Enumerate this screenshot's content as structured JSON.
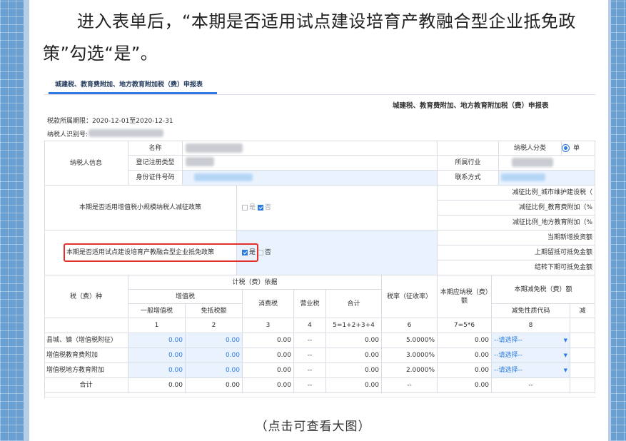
{
  "article": {
    "intro": "进入表单后，“本期是否适用试点建设培育产教融合型企业抵免政策”勾选“是”。",
    "caption": "（点击可查看大图）"
  },
  "form": {
    "tab": "城建税、教育费附加、地方教育附加税（费）申报表",
    "title": "城建税、教育费附加、地方教育附加税（费）申报表",
    "period": "税款所属期限：2020-12-01至2020-12-31",
    "taxid_label": "纳税人识别号:",
    "info": {
      "section": "纳税人信息",
      "name": "名称",
      "reg_type": "登记注册类型",
      "id_no": "身份证件号码",
      "category": "纳税人分类",
      "category_value": "单",
      "industry": "所属行业",
      "contact": "联系方式"
    },
    "q1": {
      "label": "本期是否适用增值税小规模纳税人减征政策",
      "yes": "是",
      "no": "否"
    },
    "q2": {
      "label": "本期是否适用试点建设培育产教融合型企业抵免政策",
      "yes": "是",
      "no": "否"
    },
    "right_rows": [
      "减征比例_城市维护建设税（",
      "减征比例_教育费附加（%",
      "减征比例_地方教育附加（%",
      "当期新增投资额",
      "上期留抵可抵免金额",
      "结转下期可抵免金额"
    ],
    "headers": {
      "tax_type": "税（费）种",
      "basis": "计税（费）依据",
      "vat": "增值税",
      "general_vat": "一般增值税",
      "exempt": "免抵税额",
      "consumption": "消费税",
      "business": "营业税",
      "total": "合计",
      "rate": "税率（征收率）",
      "payable": "本期应纳税（费）额",
      "relief": "本期减免税（费）额",
      "relief_code": "减免性质代码",
      "relief_amt": "减"
    },
    "colnums": [
      "1",
      "2",
      "3",
      "4",
      "5=1+2+3+4",
      "6",
      "7=5*6",
      "8"
    ],
    "rows": [
      {
        "name": "县城、镇（增值税附征）",
        "c1": "0.00",
        "c2": "0.00",
        "c3": "0.00",
        "c4": "--",
        "c5": "0.00",
        "rate": "5.0000%",
        "c7": "0.00",
        "code": "--请选择--"
      },
      {
        "name": "增值税教育费附加",
        "c1": "0.00",
        "c2": "0.00",
        "c3": "0.00",
        "c4": "--",
        "c5": "0.00",
        "rate": "3.0000%",
        "c7": "0.00",
        "code": "--请选择--"
      },
      {
        "name": "增值税地方教育附加",
        "c1": "0.00",
        "c2": "0.00",
        "c3": "0.00",
        "c4": "--",
        "c5": "0.00",
        "rate": "2.0000%",
        "c7": "0.00",
        "code": "--请选择--"
      },
      {
        "name": "合计",
        "c1": "0.00",
        "c2": "0.00",
        "c3": "0.00",
        "c4": "--",
        "c5": "0.00",
        "rate": "--",
        "c7": "0.00",
        "code": "--"
      }
    ]
  }
}
